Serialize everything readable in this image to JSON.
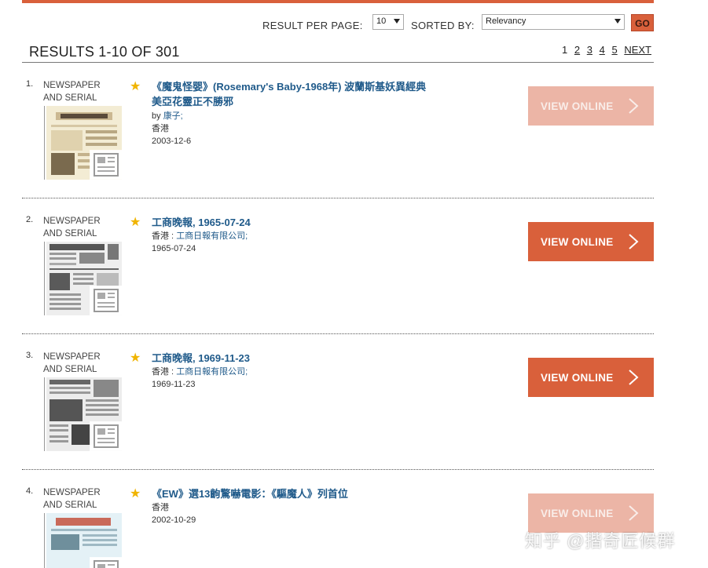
{
  "controls": {
    "results_per_page_label": "RESULT PER PAGE:",
    "results_per_page_value": "10",
    "sorted_by_label": "SORTED BY:",
    "sorted_by_value": "Relevancy",
    "go_label": "GO"
  },
  "results_heading": "RESULTS 1-10 OF 301",
  "pagination": {
    "pages": [
      "1",
      "2",
      "3",
      "4",
      "5"
    ],
    "next_label": "NEXT",
    "current": "1"
  },
  "results": [
    {
      "number": "1.",
      "type_line1": "NEWSPAPER",
      "type_line2": "AND SERIAL",
      "title_line1": "《魔鬼怪婴》(Rosemary's Baby-1968年) 波蘭斯基妖異經典",
      "title_line2": "美亞花靈正不勝邪",
      "author_prefix": "by",
      "author": "康子;",
      "place": "香港",
      "date": "2003-12-6",
      "button_label": "VIEW ONLINE"
    },
    {
      "number": "2.",
      "type_line1": "NEWSPAPER",
      "type_line2": "AND SERIAL",
      "title_line1": "工商晚報, 1965-07-24",
      "publisher_place": "香港 :",
      "publisher": "工商日報有限公司;",
      "date": "1965-07-24",
      "button_label": "VIEW ONLINE"
    },
    {
      "number": "3.",
      "type_line1": "NEWSPAPER",
      "type_line2": "AND SERIAL",
      "title_line1": "工商晚報, 1969-11-23",
      "publisher_place": "香港 :",
      "publisher": "工商日報有限公司;",
      "date": "1969-11-23",
      "button_label": "VIEW ONLINE"
    },
    {
      "number": "4.",
      "type_line1": "NEWSPAPER",
      "type_line2": "AND SERIAL",
      "title_line1": "《EW》選13齣驚嚇電影：《驅魔人》列首位",
      "place": "香港",
      "date": "2002-10-29",
      "button_label": "VIEW ONLINE"
    }
  ],
  "watermark": "知乎 @揩奇匠候群",
  "colors": {
    "accent": "#d9603b",
    "accent_faded": "#ecb5a6",
    "title_link": "#1f5a8a",
    "star": "#f0b400"
  }
}
